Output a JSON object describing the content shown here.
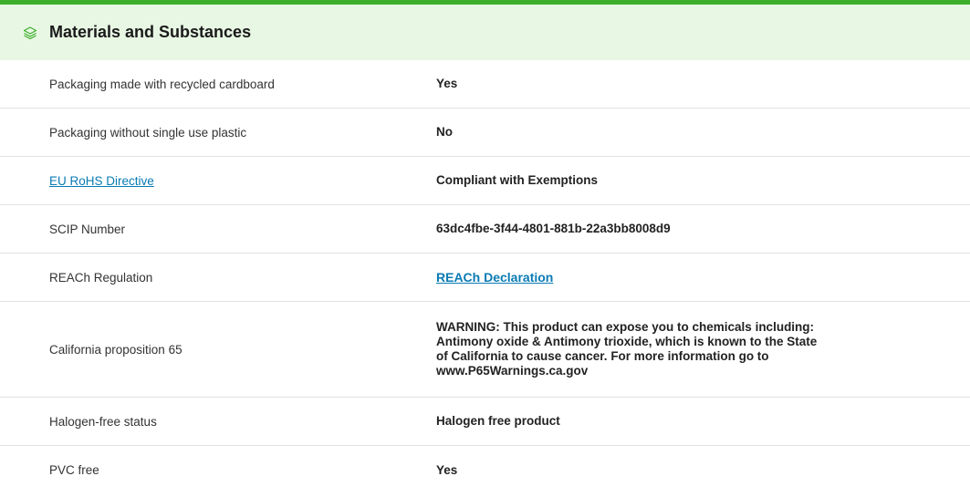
{
  "header": {
    "icon": "layers-icon",
    "title": "Materials and Substances",
    "accent_color": "#3dae2b",
    "background_color": "#e8f7e4"
  },
  "rows": [
    {
      "label": "Packaging made with recycled cardboard",
      "value": "Yes"
    },
    {
      "label": "Packaging without single use plastic",
      "value": "No"
    },
    {
      "label": "EU RoHS Directive",
      "label_is_link": true,
      "value": "Compliant with Exemptions"
    },
    {
      "label": "SCIP Number",
      "value": "63dc4fbe-3f44-4801-881b-22a3bb8008d9"
    },
    {
      "label": "REACh Regulation",
      "value": "REACh Declaration",
      "value_is_link": true
    },
    {
      "label": "California proposition 65",
      "value": "WARNING: This product can expose you to chemicals including: Antimony oxide & Antimony trioxide, which is known to the State of California to cause cancer. For more information go to www.P65Warnings.ca.gov"
    },
    {
      "label": "Halogen-free status",
      "value": "Halogen free product"
    },
    {
      "label": "PVC free",
      "value": "Yes"
    }
  ],
  "link_color": "#0a7bb3"
}
